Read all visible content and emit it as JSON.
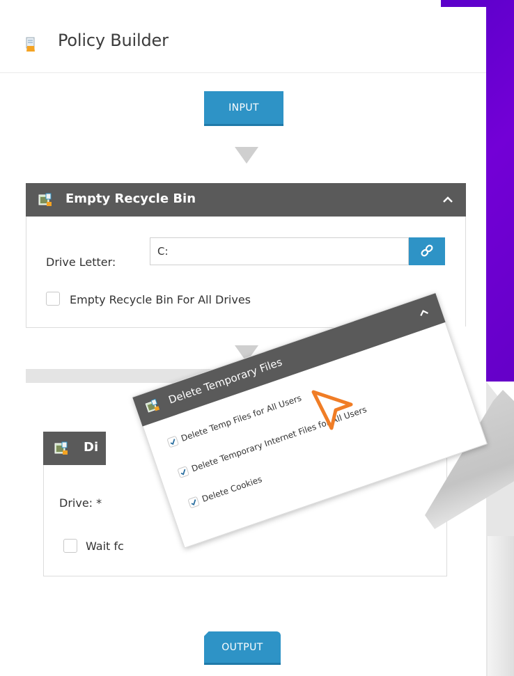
{
  "header": {
    "title": "Policy Builder",
    "icon": "policy-document-icon"
  },
  "flow": {
    "input_label": "INPUT",
    "output_label": "OUTPUT"
  },
  "cards": {
    "empty_recycle_bin": {
      "title": "Empty Recycle Bin",
      "icon": "recycle-bin-icon",
      "drive_letter_label": "Drive Letter:",
      "drive_letter_value": "C:",
      "link_icon": "link-icon",
      "all_drives_label": "Empty Recycle Bin For All Drives",
      "all_drives_checked": false
    },
    "drive": {
      "title_fragment": "Di",
      "icon": "drive-icon",
      "drive_label": "Drive: *",
      "wait_label_fragment": "Wait fc",
      "wait_checked": false
    },
    "delete_temporary_files": {
      "title": "Delete Temporary Files",
      "icon": "trash-files-icon",
      "options": [
        {
          "label": "Delete Temp Files for All Users",
          "checked": true
        },
        {
          "label": "Delete Temporary Internet Files for All Users",
          "checked": true
        },
        {
          "label": "Delete Cookies",
          "checked": true
        }
      ]
    }
  },
  "colors": {
    "accent_blue": "#2e93c6",
    "card_header": "#5a5a5a",
    "cursor_orange": "#f07d26",
    "background_purple": "#6a00cf"
  }
}
